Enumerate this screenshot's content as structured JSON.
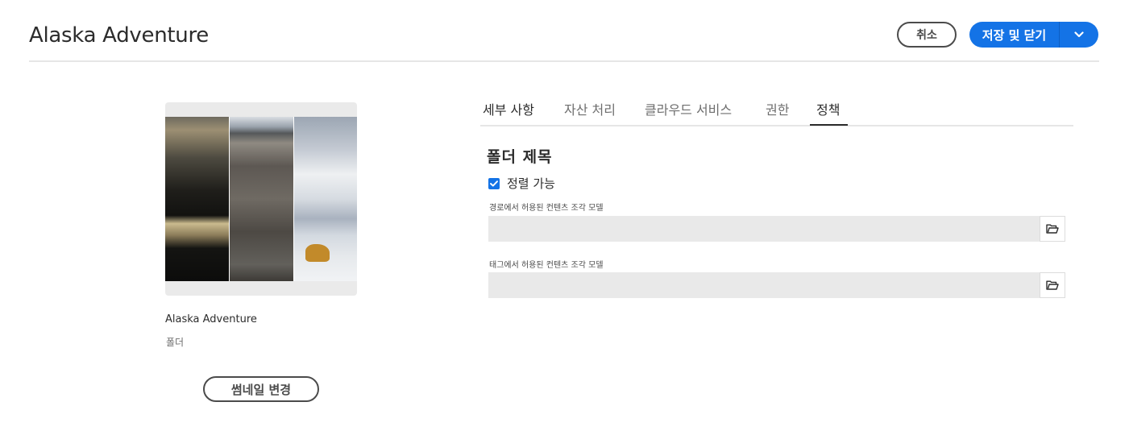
{
  "header": {
    "title": "Alaska Adventure",
    "cancel_label": "취소",
    "save_close_label": "저장 및 닫기"
  },
  "asset": {
    "name": "Alaska Adventure",
    "type": "폴더",
    "change_thumbnail_label": "썸네일 변경"
  },
  "tabs": [
    {
      "label": "세부 사항",
      "active": false
    },
    {
      "label": "자산 처리",
      "active": false
    },
    {
      "label": "클라우드 서비스",
      "active": false
    },
    {
      "label": "권한",
      "active": false
    },
    {
      "label": "정책",
      "active": true
    }
  ],
  "policy": {
    "section_title": "폴더 제목",
    "orderable_label": "정렬 가능",
    "orderable_checked": true,
    "path_field_label": "경로에서 허용된 컨텐츠 조각 모델",
    "path_field_value": "",
    "tag_field_label": "태그에서 허용된 컨텐츠 조각 모델",
    "tag_field_value": ""
  },
  "colors": {
    "accent": "#1473e6",
    "text": "#2c2c2c",
    "field_bg": "#e9e9e9"
  },
  "icons": {
    "dropdown": "chevron-down-icon",
    "checkbox": "checkmark-icon",
    "browse": "folder-icon"
  }
}
